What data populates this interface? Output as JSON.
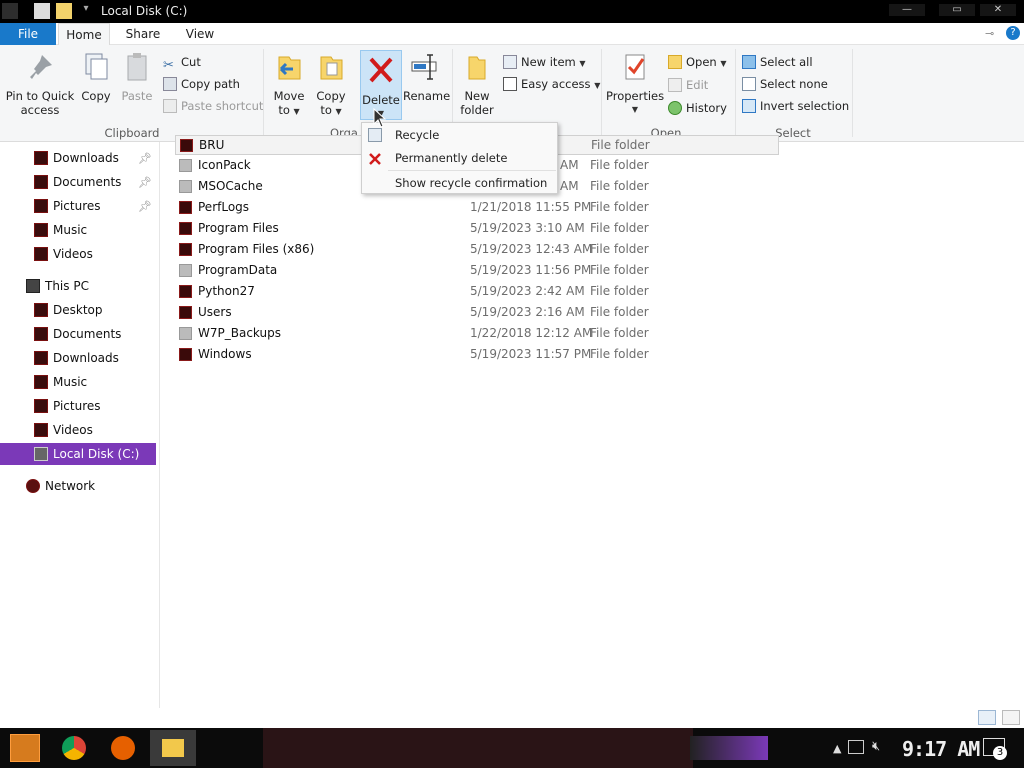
{
  "window": {
    "title": "Local Disk (C:)",
    "controls": {
      "minimize": "—",
      "maximize": "▭",
      "close": "✕"
    }
  },
  "tabs": {
    "file": "File",
    "home": "Home",
    "share": "Share",
    "view": "View"
  },
  "ribbon": {
    "clipboard": {
      "pin_line1": "Pin to Quick",
      "pin_line2": "access",
      "copy": "Copy",
      "paste": "Paste",
      "cut": "Cut",
      "copy_path": "Copy path",
      "paste_shortcut": "Paste shortcut",
      "label": "Clipboard"
    },
    "organize": {
      "move_line1": "Move",
      "move_line2": "to",
      "copy_line1": "Copy",
      "copy_line2": "to",
      "delete": "Delete",
      "rename": "Rename",
      "label": "Orga"
    },
    "new": {
      "new_folder_line1": "New",
      "new_folder_line2": "folder",
      "new_item": "New item",
      "easy_access": "Easy access"
    },
    "open": {
      "properties": "Properties",
      "open": "Open",
      "edit": "Edit",
      "history": "History",
      "label": "Open"
    },
    "select": {
      "select_all": "Select all",
      "select_none": "Select none",
      "invert_selection": "Invert selection",
      "label": "Select"
    }
  },
  "delete_menu": {
    "recycle": "Recycle",
    "permanently_delete": "Permanently delete",
    "show_confirmation": "Show recycle confirmation"
  },
  "nav": {
    "quick": [
      {
        "label": "Downloads",
        "pinned": true
      },
      {
        "label": "Documents",
        "pinned": true
      },
      {
        "label": "Pictures",
        "pinned": true
      },
      {
        "label": "Music",
        "pinned": false
      },
      {
        "label": "Videos",
        "pinned": false
      }
    ],
    "this_pc": "This PC",
    "pc_items": [
      "Desktop",
      "Documents",
      "Downloads",
      "Music",
      "Pictures",
      "Videos",
      "Local Disk (C:)"
    ],
    "network": "Network"
  },
  "files": [
    {
      "name": "BRU",
      "date": "",
      "type": "File folder"
    },
    {
      "name": "IconPack",
      "date": "",
      "type": "File folder"
    },
    {
      "name": "MSOCache",
      "date": "",
      "type": "File folder"
    },
    {
      "name": "PerfLogs",
      "date": "1/21/2018 11:55 PM",
      "type": "File folder"
    },
    {
      "name": "Program Files",
      "date": "5/19/2023 3:10 AM",
      "type": "File folder"
    },
    {
      "name": "Program Files (x86)",
      "date": "5/19/2023 12:43 AM",
      "type": "File folder"
    },
    {
      "name": "ProgramData",
      "date": "5/19/2023 11:56 PM",
      "type": "File folder"
    },
    {
      "name": "Python27",
      "date": "5/19/2023 2:42 AM",
      "type": "File folder"
    },
    {
      "name": "Users",
      "date": "5/19/2023 2:16 AM",
      "type": "File folder"
    },
    {
      "name": "W7P_Backups",
      "date": "1/22/2018 12:12 AM",
      "type": "File folder"
    },
    {
      "name": "Windows",
      "date": "5/19/2023 11:57 PM",
      "type": "File folder"
    }
  ],
  "files_partial": {
    "row1_time_fragment": "AM",
    "row2_time_fragment": "AM"
  },
  "taskbar": {
    "clock": "9:17 AM",
    "notification_count": "3"
  },
  "colors": {
    "file_tab": "#1979ca",
    "selection": "#7b39b8",
    "delete_red": "#d11b1b",
    "taskbar": "#0b0b0b"
  }
}
